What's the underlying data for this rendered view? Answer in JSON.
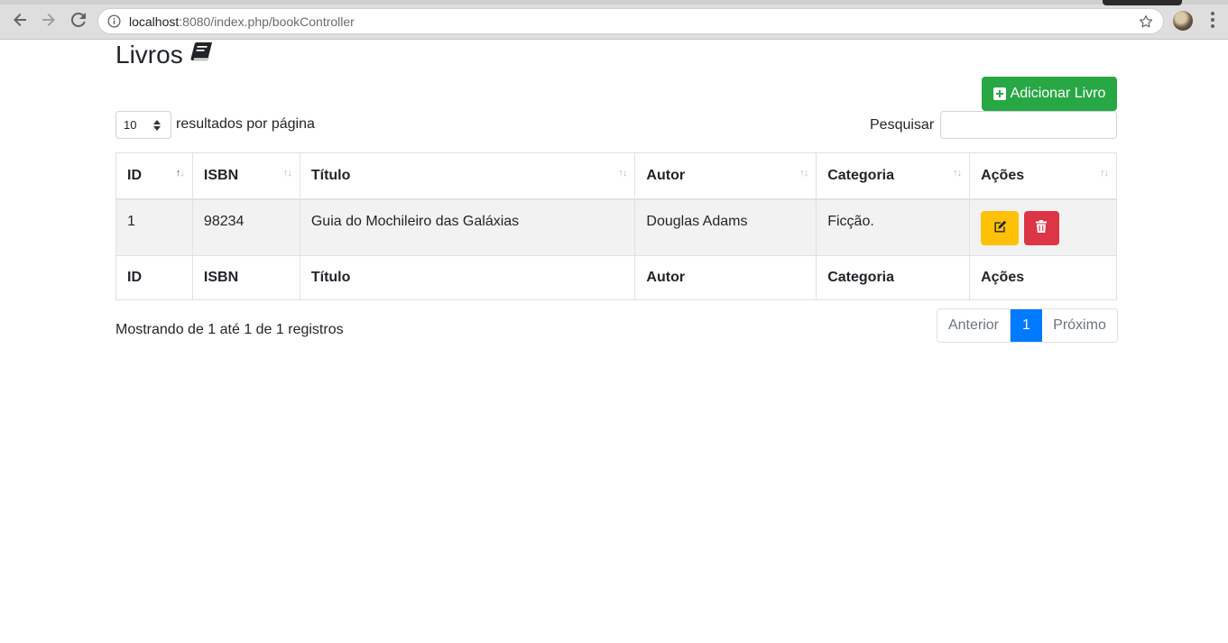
{
  "browser": {
    "url_host": "localhost",
    "url_rest": ":8080/index.php/bookController"
  },
  "page": {
    "title": "Livros",
    "add_button_label": "Adicionar Livro"
  },
  "length_control": {
    "selected": "10",
    "label": "resultados por página"
  },
  "search": {
    "label": "Pesquisar",
    "value": ""
  },
  "table": {
    "headers": [
      "ID",
      "ISBN",
      "Título",
      "Autor",
      "Categoria",
      "Ações"
    ],
    "rows": [
      {
        "id": "1",
        "isbn": "98234",
        "titulo": "Guia do Mochileiro das Galáxias",
        "autor": "Douglas Adams",
        "categoria": "Ficção."
      }
    ],
    "sort_glyph_up": "↑",
    "sort_glyph_down": "↓"
  },
  "footer": {
    "info": "Mostrando de 1 até 1 de 1 registros",
    "pagination": {
      "previous": "Anterior",
      "current": "1",
      "next": "Próximo"
    }
  },
  "colors": {
    "success": "#28a745",
    "warning": "#ffc107",
    "danger": "#dc3545",
    "primary": "#007bff"
  }
}
